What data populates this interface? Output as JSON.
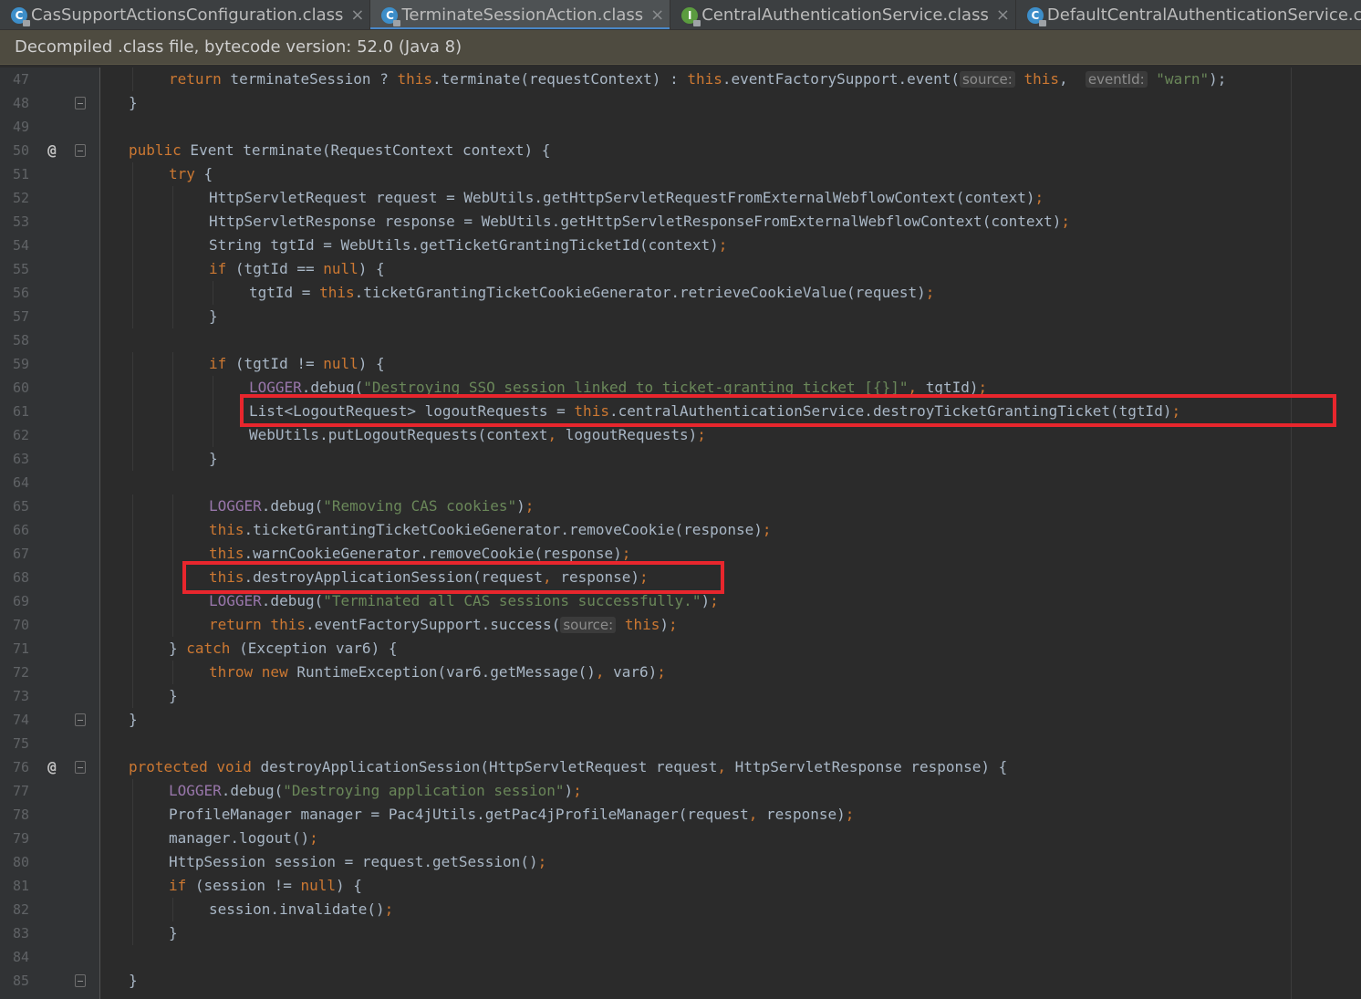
{
  "tabs": [
    {
      "label": "CasSupportActionsConfiguration.class",
      "icon": "class-icon",
      "letter": "C",
      "active": false
    },
    {
      "label": "TerminateSessionAction.class",
      "icon": "class-icon",
      "letter": "C",
      "active": true
    },
    {
      "label": "CentralAuthenticationService.class",
      "icon": "interface-icon",
      "letter": "I",
      "active": false
    },
    {
      "label": "DefaultCentralAuthenticationService.class",
      "icon": "class-icon",
      "letter": "C",
      "active": false
    }
  ],
  "tab_close_glyph": "×",
  "colors": {
    "class_icon": "#3d8ec9",
    "interface_icon": "#5b9c3f",
    "highlight": "#e8262d"
  },
  "banner": {
    "text": "Decompiled .class file, bytecode version: 52.0 (Java 8)"
  },
  "editor": {
    "lines": [
      {
        "n": "47",
        "indent": 2,
        "tokens": [
          [
            "kw",
            "return"
          ],
          [
            "t",
            " terminateSession ? "
          ],
          [
            "kw",
            "this"
          ],
          [
            "t",
            ".terminate(requestContext) : "
          ],
          [
            "kw",
            "this"
          ],
          [
            "t",
            ".eventFactorySupport.event("
          ],
          [
            "hint",
            "source:"
          ],
          [
            "t",
            " "
          ],
          [
            "kw",
            "this"
          ],
          [
            "t",
            ",  "
          ],
          [
            "hint",
            "eventId:"
          ],
          [
            "t",
            " "
          ],
          [
            "str",
            "\"warn\""
          ],
          [
            "t",
            ");"
          ]
        ]
      },
      {
        "n": "48",
        "indent": 1,
        "fold": true,
        "tokens": [
          [
            "t",
            "}"
          ]
        ]
      },
      {
        "n": "49",
        "indent": 0,
        "tokens": []
      },
      {
        "n": "50",
        "indent": 1,
        "marker": "@",
        "fold": true,
        "tokens": [
          [
            "kw",
            "public"
          ],
          [
            "t",
            " Event terminate(RequestContext context) {"
          ]
        ]
      },
      {
        "n": "51",
        "indent": 2,
        "tokens": [
          [
            "kw",
            "try"
          ],
          [
            "t",
            " {"
          ]
        ]
      },
      {
        "n": "52",
        "indent": 3,
        "tokens": [
          [
            "t",
            "HttpServletRequest request = WebUtils.getHttpServletRequestFromExternalWebflowContext(context)"
          ],
          [
            "kw",
            ";"
          ]
        ]
      },
      {
        "n": "53",
        "indent": 3,
        "tokens": [
          [
            "t",
            "HttpServletResponse response = WebUtils.getHttpServletResponseFromExternalWebflowContext(context)"
          ],
          [
            "kw",
            ";"
          ]
        ]
      },
      {
        "n": "54",
        "indent": 3,
        "tokens": [
          [
            "t",
            "String tgtId = WebUtils.getTicketGrantingTicketId(context)"
          ],
          [
            "kw",
            ";"
          ]
        ]
      },
      {
        "n": "55",
        "indent": 3,
        "tokens": [
          [
            "kw",
            "if"
          ],
          [
            "t",
            " (tgtId == "
          ],
          [
            "kw",
            "null"
          ],
          [
            "t",
            ") {"
          ]
        ]
      },
      {
        "n": "56",
        "indent": 4,
        "tokens": [
          [
            "t",
            "tgtId = "
          ],
          [
            "kw",
            "this"
          ],
          [
            "t",
            ".ticketGrantingTicketCookieGenerator.retrieveCookieValue(request)"
          ],
          [
            "kw",
            ";"
          ]
        ]
      },
      {
        "n": "57",
        "indent": 3,
        "tokens": [
          [
            "t",
            "}"
          ]
        ]
      },
      {
        "n": "58",
        "indent": 0,
        "tokens": []
      },
      {
        "n": "59",
        "indent": 3,
        "tokens": [
          [
            "kw",
            "if"
          ],
          [
            "t",
            " (tgtId != "
          ],
          [
            "kw",
            "null"
          ],
          [
            "t",
            ") {"
          ]
        ]
      },
      {
        "n": "60",
        "indent": 4,
        "tokens": [
          [
            "fld",
            "LOGGER"
          ],
          [
            "t",
            ".debug("
          ],
          [
            "str",
            "\"Destroying SSO session linked to ticket-granting ticket [{}]\""
          ],
          [
            "kw",
            ","
          ],
          [
            "t",
            " tgtId)"
          ],
          [
            "kw",
            ";"
          ]
        ]
      },
      {
        "n": "61",
        "indent": 4,
        "tokens": [
          [
            "t",
            "List<LogoutRequest> logoutRequests = "
          ],
          [
            "kw",
            "this"
          ],
          [
            "t",
            ".centralAuthenticationService.destroyTicketGrantingTicket(tgtId)"
          ],
          [
            "kw",
            ";"
          ]
        ]
      },
      {
        "n": "62",
        "indent": 4,
        "tokens": [
          [
            "t",
            "WebUtils.putLogoutRequests(context"
          ],
          [
            "kw",
            ","
          ],
          [
            "t",
            " logoutRequests)"
          ],
          [
            "kw",
            ";"
          ]
        ]
      },
      {
        "n": "63",
        "indent": 3,
        "tokens": [
          [
            "t",
            "}"
          ]
        ]
      },
      {
        "n": "64",
        "indent": 0,
        "tokens": []
      },
      {
        "n": "65",
        "indent": 3,
        "tokens": [
          [
            "fld",
            "LOGGER"
          ],
          [
            "t",
            ".debug("
          ],
          [
            "str",
            "\"Removing CAS cookies\""
          ],
          [
            "t",
            ")"
          ],
          [
            "kw",
            ";"
          ]
        ]
      },
      {
        "n": "66",
        "indent": 3,
        "tokens": [
          [
            "kw",
            "this"
          ],
          [
            "t",
            ".ticketGrantingTicketCookieGenerator.removeCookie(response)"
          ],
          [
            "kw",
            ";"
          ]
        ]
      },
      {
        "n": "67",
        "indent": 3,
        "tokens": [
          [
            "kw",
            "this"
          ],
          [
            "t",
            ".warnCookieGenerator.removeCookie(response)"
          ],
          [
            "kw",
            ";"
          ]
        ]
      },
      {
        "n": "68",
        "indent": 3,
        "tokens": [
          [
            "kw",
            "this"
          ],
          [
            "t",
            ".destroyApplicationSession(request"
          ],
          [
            "kw",
            ","
          ],
          [
            "t",
            " response)"
          ],
          [
            "kw",
            ";"
          ]
        ]
      },
      {
        "n": "69",
        "indent": 3,
        "tokens": [
          [
            "fld",
            "LOGGER"
          ],
          [
            "t",
            ".debug("
          ],
          [
            "str",
            "\"Terminated all CAS sessions successfully.\""
          ],
          [
            "t",
            ")"
          ],
          [
            "kw",
            ";"
          ]
        ]
      },
      {
        "n": "70",
        "indent": 3,
        "tokens": [
          [
            "kw",
            "return this"
          ],
          [
            "t",
            ".eventFactorySupport.success("
          ],
          [
            "hint",
            "source:"
          ],
          [
            "t",
            " "
          ],
          [
            "kw",
            "this"
          ],
          [
            "t",
            ")"
          ],
          [
            "kw",
            ";"
          ]
        ]
      },
      {
        "n": "71",
        "indent": 2,
        "tokens": [
          [
            "t",
            "} "
          ],
          [
            "kw",
            "catch"
          ],
          [
            "t",
            " (Exception var6) {"
          ]
        ]
      },
      {
        "n": "72",
        "indent": 3,
        "tokens": [
          [
            "kw",
            "throw new"
          ],
          [
            "t",
            " RuntimeException(var6.getMessage()"
          ],
          [
            "kw",
            ","
          ],
          [
            "t",
            " var6)"
          ],
          [
            "kw",
            ";"
          ]
        ]
      },
      {
        "n": "73",
        "indent": 2,
        "tokens": [
          [
            "t",
            "}"
          ]
        ]
      },
      {
        "n": "74",
        "indent": 1,
        "fold": true,
        "tokens": [
          [
            "t",
            "}"
          ]
        ]
      },
      {
        "n": "75",
        "indent": 0,
        "tokens": []
      },
      {
        "n": "76",
        "indent": 1,
        "marker": "@",
        "fold": true,
        "tokens": [
          [
            "kw",
            "protected void"
          ],
          [
            "t",
            " destroyApplicationSession(HttpServletRequest request"
          ],
          [
            "kw",
            ","
          ],
          [
            "t",
            " HttpServletResponse response) {"
          ]
        ]
      },
      {
        "n": "77",
        "indent": 2,
        "tokens": [
          [
            "fld",
            "LOGGER"
          ],
          [
            "t",
            ".debug("
          ],
          [
            "str",
            "\"Destroying application session\""
          ],
          [
            "t",
            ")"
          ],
          [
            "kw",
            ";"
          ]
        ]
      },
      {
        "n": "78",
        "indent": 2,
        "tokens": [
          [
            "t",
            "ProfileManager manager = Pac4jUtils.getPac4jProfileManager(request"
          ],
          [
            "kw",
            ","
          ],
          [
            "t",
            " response)"
          ],
          [
            "kw",
            ";"
          ]
        ]
      },
      {
        "n": "79",
        "indent": 2,
        "tokens": [
          [
            "t",
            "manager.logout()"
          ],
          [
            "kw",
            ";"
          ]
        ]
      },
      {
        "n": "80",
        "indent": 2,
        "tokens": [
          [
            "t",
            "HttpSession session = request.getSession()"
          ],
          [
            "kw",
            ";"
          ]
        ]
      },
      {
        "n": "81",
        "indent": 2,
        "tokens": [
          [
            "kw",
            "if"
          ],
          [
            "t",
            " (session != "
          ],
          [
            "kw",
            "null"
          ],
          [
            "t",
            ") {"
          ]
        ]
      },
      {
        "n": "82",
        "indent": 3,
        "tokens": [
          [
            "t",
            "session.invalidate()"
          ],
          [
            "kw",
            ";"
          ]
        ]
      },
      {
        "n": "83",
        "indent": 2,
        "tokens": [
          [
            "t",
            "}"
          ]
        ]
      },
      {
        "n": "84",
        "indent": 0,
        "tokens": []
      },
      {
        "n": "85",
        "indent": 1,
        "fold": true,
        "tokens": [
          [
            "t",
            "}"
          ]
        ]
      }
    ]
  }
}
